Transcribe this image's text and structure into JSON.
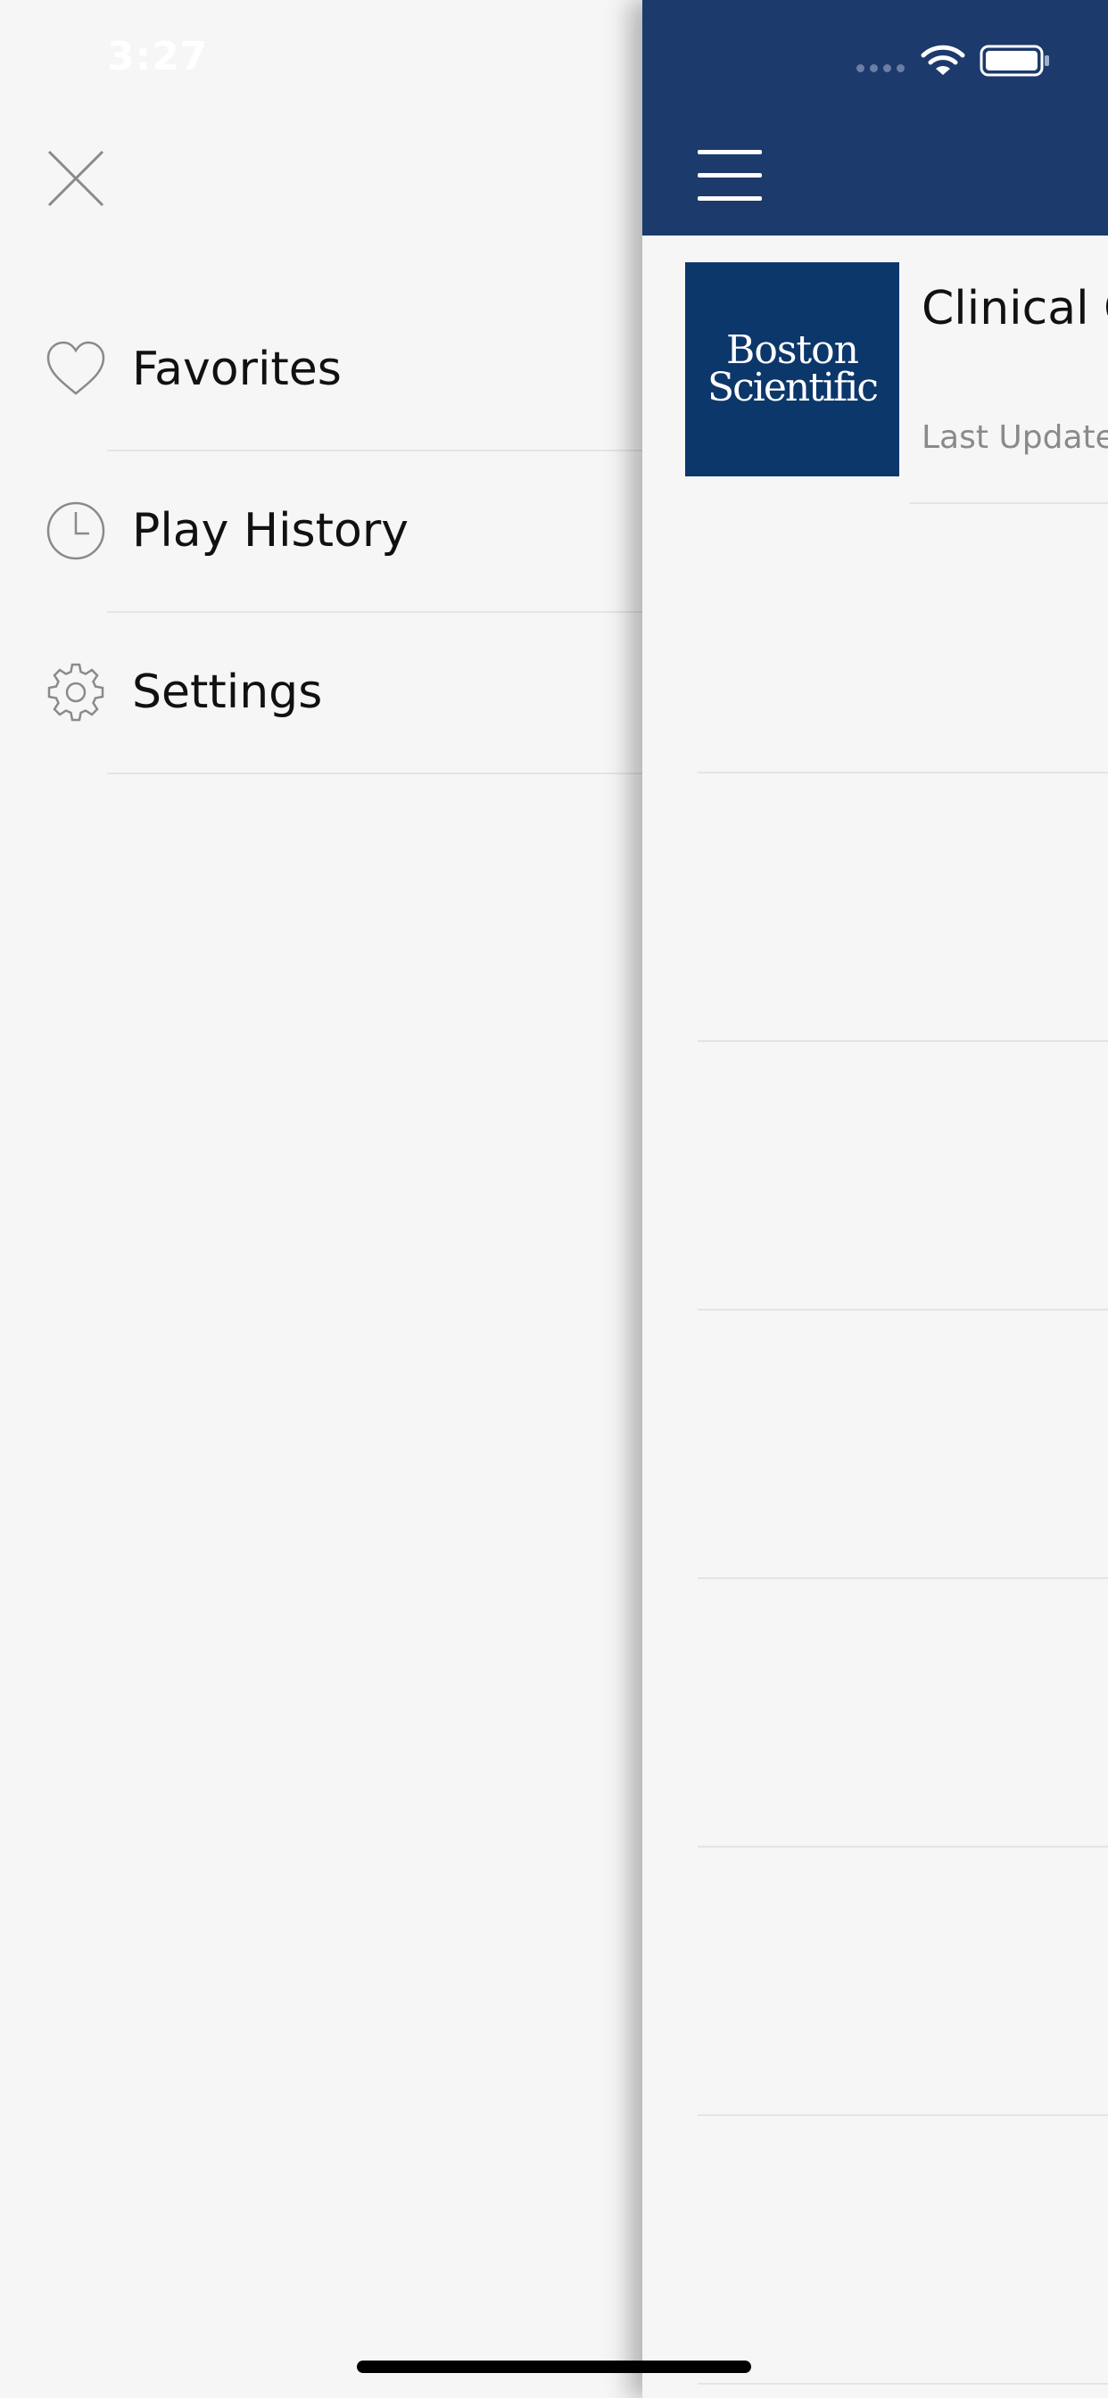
{
  "status_bar": {
    "time": "3:27"
  },
  "drawer": {
    "close_icon": "close-icon",
    "items": [
      {
        "label": "Favorites",
        "icon": "heart-icon"
      },
      {
        "label": "Play History",
        "icon": "clock-icon"
      },
      {
        "label": "Settings",
        "icon": "gear-icon"
      }
    ]
  },
  "main": {
    "header_color": "#1c3a6b",
    "menu_icon": "hamburger-icon",
    "podcast": {
      "logo_line1": "Boston",
      "logo_line2": "Scientific",
      "title": "Clinical C",
      "last_update": "Last Update:"
    }
  },
  "colors": {
    "drawer_bg": "#f6f6f6",
    "header": "#1c3a6b",
    "logo_bg": "#0c376b",
    "divider": "#e4e4e4"
  }
}
